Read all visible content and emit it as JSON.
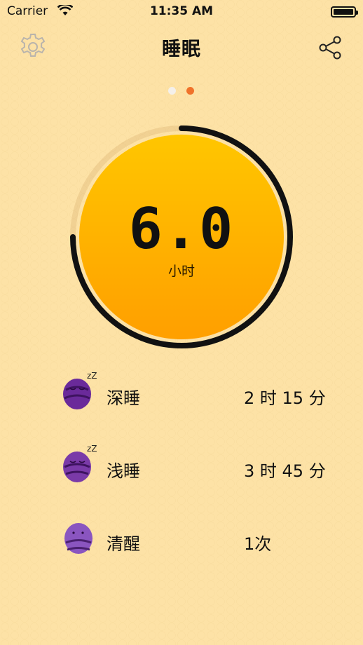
{
  "status_bar": {
    "carrier": "Carrier",
    "time": "11:35 AM"
  },
  "nav": {
    "title": "睡眠",
    "settings_icon": "gear-icon",
    "share_icon": "share-icon"
  },
  "pager": {
    "count": 2,
    "active_index": 1
  },
  "gauge": {
    "value": "6.0",
    "unit": "小时",
    "progress": 0.75,
    "ring_color": "#111111",
    "fill_top": "#ffc600",
    "fill_bottom": "#ff9f00"
  },
  "stages": [
    {
      "label": "深睡",
      "value": "2 时 15 分",
      "icon": "sleeping-bean-icon",
      "color": "#6a2a9a",
      "zz": "zZ"
    },
    {
      "label": "浅睡",
      "value": "3 时 45 分",
      "icon": "sleeping-bean-icon",
      "color": "#7a3aa8",
      "zz": "zZ"
    },
    {
      "label": "清醒",
      "value": "1次",
      "icon": "awake-bean-icon",
      "color": "#8a55c0",
      "zz": ""
    }
  ],
  "colors": {
    "background": "#fde2a6",
    "accent_dot": "#f0722a"
  }
}
